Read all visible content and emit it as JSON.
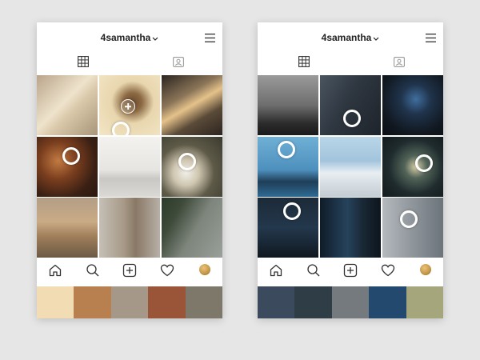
{
  "phones": [
    {
      "username": "4samantha",
      "icons": {
        "menu": "hamburger-menu-icon",
        "grid_tab": "grid-icon",
        "tagged_tab": "tagged-photos-icon",
        "nav": [
          "home-icon",
          "search-icon",
          "add-post-icon",
          "heart-icon",
          "profile-avatar"
        ]
      },
      "avatar_color": "#c89a4a",
      "tiles": [
        {
          "style": "linear-gradient(135deg,#b8a48a 0%,#efe3cc 45%,#d8c7a8 60%,#a8957a 100%)"
        },
        {
          "style": "radial-gradient(circle at 55% 45%,#6b4a2e 0%,#8c6a44 20%,#e8d6ae 45%,#f3e6c6 100%)"
        },
        {
          "style": "linear-gradient(150deg,#2a2420 0%,#8b7558 35%,#e5c28a 50%,#5a4a38 70%,#2c2520 100%)"
        },
        {
          "style": "radial-gradient(circle at 35% 40%,#c27a42 0%,#7a3e1e 35%,#3a2014 70%,#2a1810 100%)"
        },
        {
          "style": "linear-gradient(180deg,#f3f2ef 0%,#e6e5e2 55%,#c9c8c4 70%,#dad9d5 100%)"
        },
        {
          "style": "radial-gradient(circle at 40% 60%,#f0efe8 0%,#cfc6b0 25%,#5e5a48 55%,#3a3a2e 100%)"
        },
        {
          "style": "linear-gradient(180deg,#b39e86 0%,#c9ab86 40%,#9f7e5a 65%,#6c5a46 100%)"
        },
        {
          "style": "linear-gradient(90deg,#c4bfb6 0%,#a89a88 40%,#8a7866 60%,#b7b0a6 100%)"
        },
        {
          "style": "linear-gradient(120deg,#2a3a2a 0%,#3e4a3a 25%,#7e857c 55%,#9aa09a 100%)"
        }
      ],
      "markers": [
        null,
        "plus+ring",
        null,
        "ring",
        null,
        "ring",
        null,
        null,
        null
      ],
      "palette": [
        "#f2dcb3",
        "#b9804f",
        "#a59888",
        "#9a5538",
        "#7d786a"
      ]
    },
    {
      "username": "4samantha",
      "icons": {
        "menu": "hamburger-menu-icon",
        "grid_tab": "grid-icon",
        "tagged_tab": "tagged-photos-icon",
        "nav": [
          "home-icon",
          "search-icon",
          "add-post-icon",
          "heart-icon",
          "profile-avatar"
        ]
      },
      "avatar_color": "#c89a4a",
      "tiles": [
        {
          "style": "linear-gradient(180deg,#9a9a9a 0%,#6e6e6e 50%,#2c2c2c 80%,#1a1a1a 100%)"
        },
        {
          "style": "linear-gradient(120deg,#4a5560 0%,#2e3640 45%,#1e242b 100%)"
        },
        {
          "style": "radial-gradient(circle at 55% 40%,#3f6e9e 0%,#20344c 30%,#111820 70%,#0b0f14 100%)"
        },
        {
          "style": "linear-gradient(180deg,#6fb0d6 0%,#4e90bd 55%,#1f3e58 75%,#2f6b93 100%)"
        },
        {
          "style": "linear-gradient(180deg,#b9d6e8 0%,#a2c4dc 40%,#e8eef2 60%,#c3ccd2 100%)"
        },
        {
          "style": "radial-gradient(circle at 55% 50%,#d8d0a8 0%,#526458 25%,#1f2b2e 60%,#121a1c 100%)"
        },
        {
          "style": "linear-gradient(180deg,#1c2a38 0%,#23384c 50%,#101820 100%)"
        },
        {
          "style": "linear-gradient(90deg,#0f1c28 0%,#26435c 45%,#1a2836 70%,#0d151d 100%)"
        },
        {
          "style": "linear-gradient(90deg,#b4b9bd 0%,#8e959b 50%,#6c747b 100%)"
        }
      ],
      "markers": [
        null,
        "ring",
        null,
        "ring",
        null,
        "ring",
        "ring",
        null,
        "ring"
      ],
      "palette": [
        "#3b4a5c",
        "#2f3e46",
        "#747a7e",
        "#234a6e",
        "#a5a67c"
      ]
    }
  ]
}
